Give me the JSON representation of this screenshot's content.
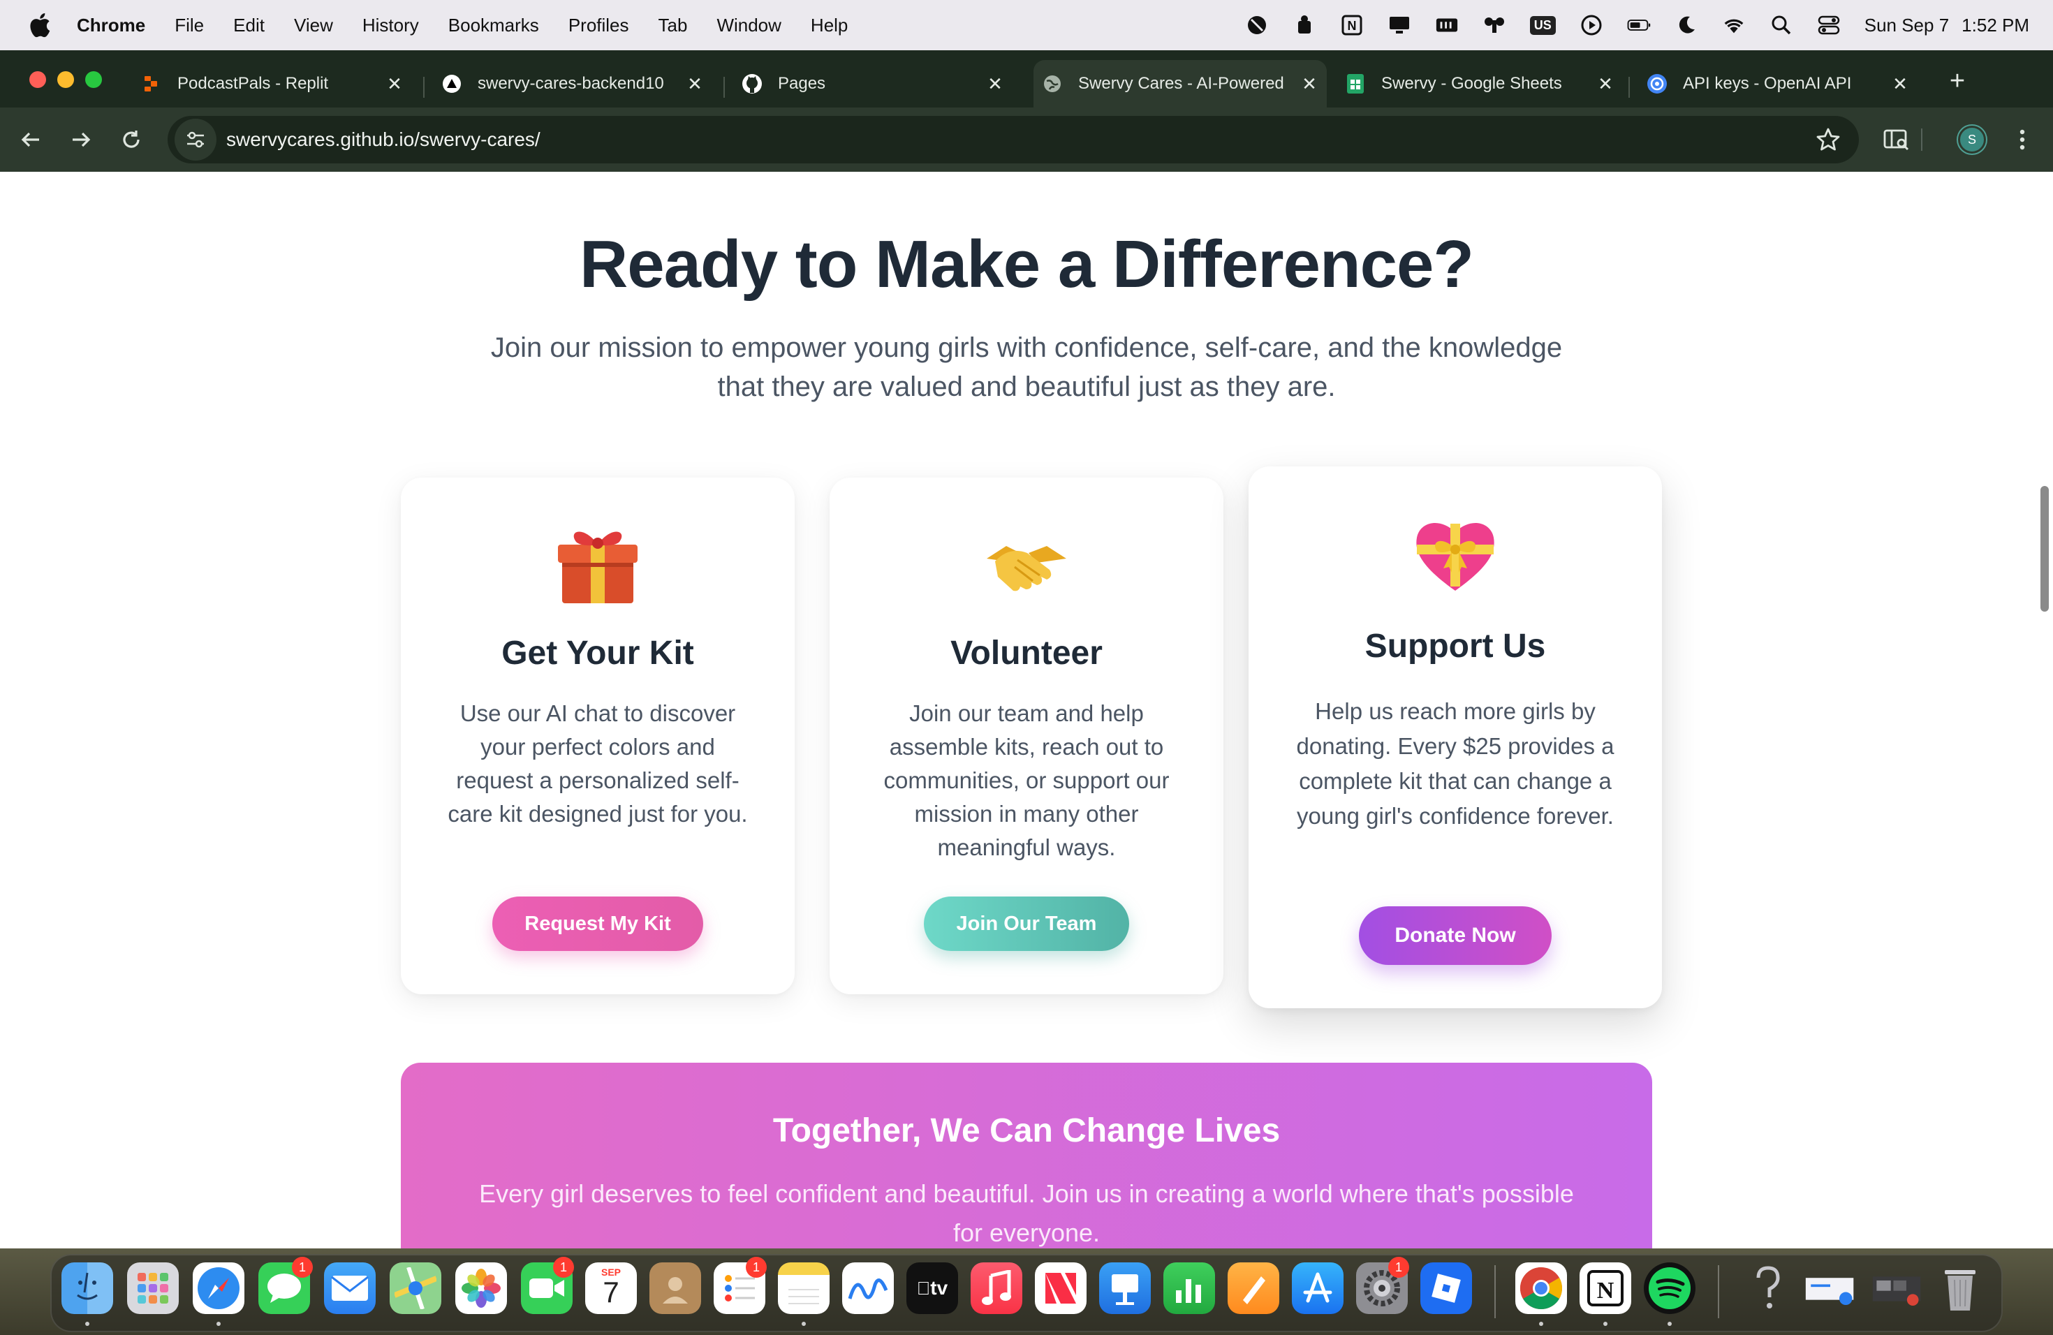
{
  "menubar": {
    "app_name": "Chrome",
    "items": [
      "File",
      "Edit",
      "View",
      "History",
      "Bookmarks",
      "Profiles",
      "Tab",
      "Window",
      "Help"
    ],
    "keyboard_layout": "US",
    "date": "Sun Sep 7",
    "time": "1:52 PM"
  },
  "browser": {
    "tabs": [
      {
        "title": "PodcastPals - Replit",
        "icon": "replit-icon",
        "active": false
      },
      {
        "title": "swervy-cares-backend10",
        "icon": "vercel-icon",
        "active": false
      },
      {
        "title": "Pages",
        "icon": "github-icon",
        "active": false
      },
      {
        "title": "Swervy Cares - AI-Powered",
        "icon": "globe-icon",
        "active": true
      },
      {
        "title": "Swervy - Google Sheets",
        "icon": "sheets-icon",
        "active": false
      },
      {
        "title": "API keys - OpenAI API",
        "icon": "openai-icon",
        "active": false
      }
    ],
    "url": "swervycares.github.io/swervy-cares/",
    "profile_initial": "S"
  },
  "page": {
    "headline": "Ready to Make a Difference?",
    "lead": "Join our mission to empower young girls with confidence, self-care, and the knowledge that they are valued and beautiful just as they are.",
    "cards": [
      {
        "icon": "gift-icon",
        "title": "Get Your Kit",
        "text": "Use our AI chat to discover your perfect colors and request a personalized self-care kit designed just for you.",
        "button": "Request My Kit",
        "color_start": "#ec5fb4",
        "color_end": "#e35ca8"
      },
      {
        "icon": "handshake-icon",
        "title": "Volunteer",
        "text": "Join our team and help assemble kits, reach out to communities, or support our mission in many other meaningful ways.",
        "button": "Join Our Team",
        "color_start": "#6ed8c8",
        "color_end": "#52b3a6"
      },
      {
        "icon": "heart-ribbon-icon",
        "title": "Support Us",
        "text": "Help us reach more girls by donating. Every $25 provides a complete kit that can change a young girl's confidence forever.",
        "button": "Donate Now",
        "color_start": "#a24fe3",
        "color_end": "#d04fc6"
      }
    ],
    "banner": {
      "title": "Together, We Can Change Lives",
      "text": "Every girl deserves to feel confident and beautiful. Join us in creating a world where that's possible for everyone."
    }
  },
  "dock": {
    "apps": [
      "Finder",
      "Launchpad",
      "Safari",
      "Messages",
      "Mail",
      "Maps",
      "Photos",
      "FaceTime",
      "Calendar",
      "Contacts",
      "Reminders",
      "Notes",
      "Freeform",
      "TV",
      "Music",
      "News",
      "Keynote",
      "Numbers",
      "Pages",
      "App Store",
      "System Settings",
      "Roblox",
      "Chrome",
      "Notion",
      "Spotify",
      "Help",
      "Preview",
      "Screenshot",
      "Trash"
    ],
    "badge_count": "1",
    "calendar_month": "SEP",
    "calendar_day": "7",
    "tv_label": "tv"
  }
}
